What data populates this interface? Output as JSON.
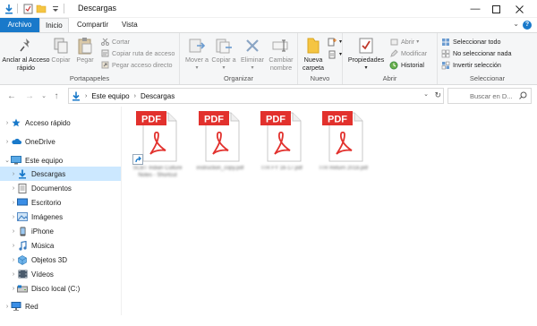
{
  "window": {
    "title": "Descargas"
  },
  "ribbon_tabs": [
    "Archivo",
    "Inicio",
    "Compartir",
    "Vista"
  ],
  "ribbon": {
    "portapapeles": {
      "label": "Portapapeles",
      "anclar": "Anclar al Acceso rápido",
      "copiar": "Copiar",
      "pegar": "Pegar",
      "cortar": "Cortar",
      "copiar_ruta": "Copiar ruta de acceso",
      "pegar_acceso": "Pegar acceso directo"
    },
    "organizar": {
      "label": "Organizar",
      "mover": "Mover a",
      "copiar": "Copiar a",
      "eliminar": "Eliminar",
      "cambiar": "Cambiar nombre"
    },
    "nuevo": {
      "label": "Nuevo",
      "nueva_carpeta": "Nueva carpeta"
    },
    "abrir": {
      "label": "Abrir",
      "propiedades": "Propiedades",
      "abrir": "Abrir",
      "modificar": "Modificar",
      "historial": "Historial"
    },
    "seleccionar": {
      "label": "Seleccionar",
      "todo": "Seleccionar todo",
      "nada": "No seleccionar nada",
      "invertir": "Invertir selección"
    }
  },
  "address": {
    "crumbs": [
      "Este equipo",
      "Descargas"
    ],
    "search_placeholder": "Buscar en D..."
  },
  "sidebar": [
    {
      "label": "Acceso rápido",
      "icon": "star-icon"
    },
    {
      "label": "OneDrive",
      "icon": "cloud-icon"
    },
    {
      "label": "Este equipo",
      "icon": "computer-icon"
    },
    {
      "label": "Descargas",
      "icon": "download-icon"
    },
    {
      "label": "Documentos",
      "icon": "documents-icon"
    },
    {
      "label": "Escritorio",
      "icon": "desktop-icon"
    },
    {
      "label": "Imágenes",
      "icon": "pictures-icon"
    },
    {
      "label": "iPhone",
      "icon": "phone-icon"
    },
    {
      "label": "Música",
      "icon": "music-icon"
    },
    {
      "label": "Objetos 3D",
      "icon": "cube-icon"
    },
    {
      "label": "Vídeos",
      "icon": "video-icon"
    },
    {
      "label": "Disco local (C:)",
      "icon": "drive-icon"
    },
    {
      "label": "Red",
      "icon": "network-icon"
    }
  ],
  "files": [
    {
      "name": "SCBT Indian Culture Notes - Shortcut",
      "badge": "PDF",
      "shortcut": true
    },
    {
      "name": "instruction_copy.pdf",
      "badge": "PDF",
      "shortcut": false
    },
    {
      "name": "ITR FY 16-17.pdf",
      "badge": "PDF",
      "shortcut": false
    },
    {
      "name": "ITR Return 2018.pdf",
      "badge": "PDF",
      "shortcut": false
    }
  ],
  "colors": {
    "accent": "#1979ca",
    "pdf_red": "#e2312d",
    "selection": "#cce8ff"
  }
}
